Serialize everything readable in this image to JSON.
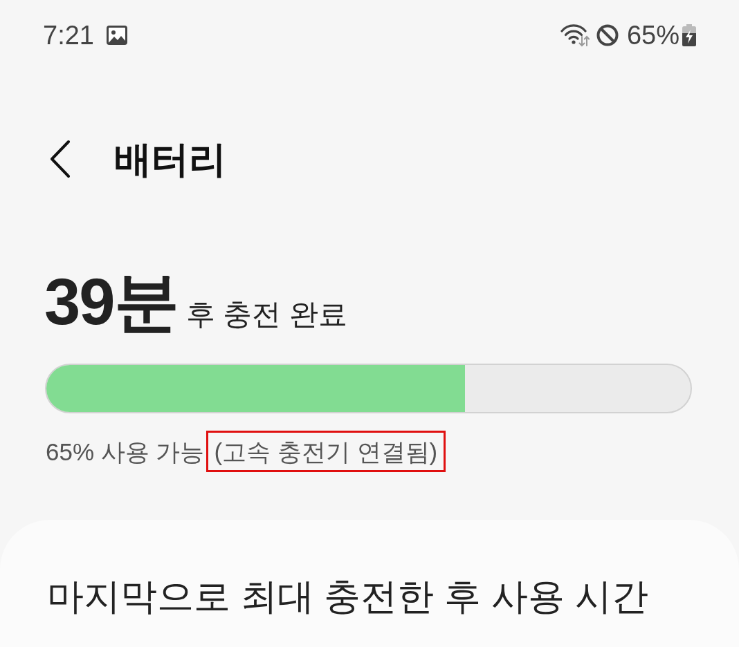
{
  "status_bar": {
    "time": "7:21",
    "battery": "65%"
  },
  "header": {
    "title": "배터리"
  },
  "charge": {
    "time": "39분",
    "caption": "후 충전 완료",
    "level": 0.65,
    "available": "65% 사용 가능",
    "charger": {
      "text": "(고속 충전기 연결됨)",
      "highlighted": true
    }
  },
  "usage_card": {
    "title": "마지막으로 최대 충전한 후 사용 시간"
  }
}
